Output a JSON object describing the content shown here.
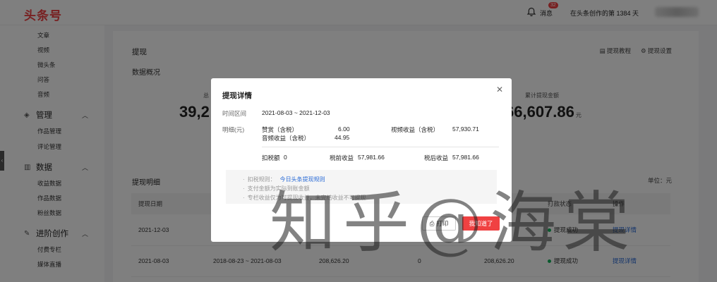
{
  "header": {
    "logo": "头条号",
    "messages_label": "消息",
    "messages_badge": "32",
    "days_text": "在头条创作的第 1384 天"
  },
  "sidebar": {
    "content_items": [
      "文章",
      "视频",
      "微头条",
      "问答",
      "音频"
    ],
    "groups": [
      {
        "label": "管理",
        "icon": "layers-icon",
        "items": [
          "作品管理",
          "评论管理"
        ]
      },
      {
        "label": "数据",
        "icon": "bar-chart-icon",
        "items": [
          "收益数据",
          "作品数据",
          "粉丝数据"
        ]
      },
      {
        "label": "进阶创作",
        "icon": "edit-doc-icon",
        "items": [
          "付费专栏",
          "媒体直播"
        ]
      }
    ]
  },
  "main": {
    "title": "提现",
    "links": [
      "提现教程",
      "提现设置"
    ],
    "subtitle": "数据概况",
    "stats": [
      {
        "label": "总",
        "value": "39,2"
      },
      {
        "label": "累计提现金额",
        "value": "66,607.86",
        "unit": "元"
      }
    ],
    "records_title": "提现明细",
    "unit_label": "单位：元",
    "columns": [
      "提现日期",
      "",
      "",
      "",
      "",
      "打款状态",
      "操作"
    ],
    "rows": [
      {
        "date": "2021-12-03",
        "period": "",
        "amount": "",
        "tax": "",
        "after": "5",
        "status": "提现成功",
        "action": "提现详情"
      },
      {
        "date": "2021-08-03",
        "period": "2018-08-23 ~ 2021-08-03",
        "amount": "208,626.20",
        "tax": "0",
        "after": "208,626.20",
        "status": "提现成功",
        "action": "提现详情"
      }
    ]
  },
  "modal": {
    "title": "提现详情",
    "period_label": "时间区间",
    "period_value": "2021-08-03 ~ 2021-12-03",
    "detail_label": "明细(元)",
    "reward_label": "赞赏（含税）",
    "reward_value": "6.00",
    "video_label": "视频收益（含税）",
    "video_value": "57,930.71",
    "audio_label": "音频收益（含税）",
    "audio_value": "44.95",
    "deduct_label": "扣税额",
    "deduct_value": "0",
    "pretax_label": "税前收益",
    "pretax_value": "57,981.66",
    "aftertax_label": "税后收益",
    "aftertax_value": "57,981.66",
    "notes": [
      {
        "text": "扣税规则：",
        "link": "今日头条提现规则"
      },
      {
        "text": "支付金额为实际到账金额"
      },
      {
        "text": "专栏收益仅为可提现收益，未完结收益不可提现"
      }
    ],
    "print_label": "打印",
    "ok_label": "我知道了"
  },
  "watermark": "知乎@海棠",
  "colors": {
    "brand": "#f04142",
    "link": "#2a6bd6",
    "success": "#12b35a"
  }
}
